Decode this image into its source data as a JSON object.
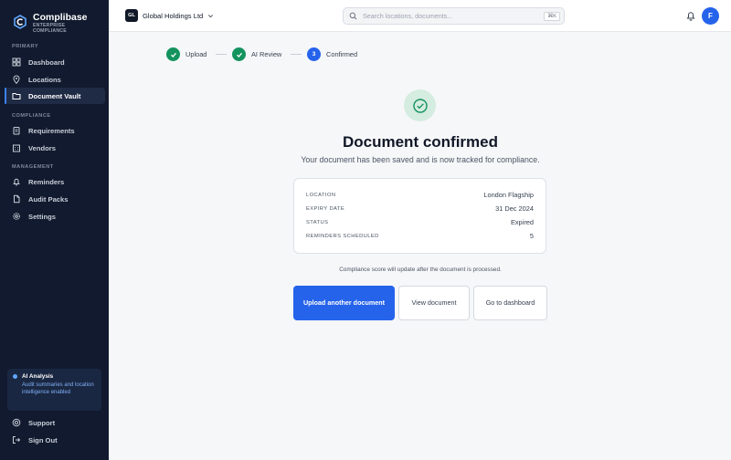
{
  "brand": {
    "name": "Complibase",
    "tagline_line1": "ENTERPRISE",
    "tagline_line2": "COMPLIANCE"
  },
  "sidebar": {
    "sections": {
      "primary": "PRIMARY",
      "compliance": "COMPLIANCE",
      "management": "MANAGEMENT"
    },
    "items": [
      {
        "label": "Dashboard",
        "icon": "grid-icon"
      },
      {
        "label": "Locations",
        "icon": "map-pin-icon"
      },
      {
        "label": "Document Vault",
        "icon": "folder-icon",
        "active": true
      },
      {
        "label": "Requirements",
        "icon": "clipboard-icon"
      },
      {
        "label": "Vendors",
        "icon": "building-icon"
      },
      {
        "label": "Reminders",
        "icon": "bell-icon"
      },
      {
        "label": "Audit Packs",
        "icon": "file-icon"
      },
      {
        "label": "Settings",
        "icon": "gear-icon"
      }
    ],
    "ai_card": {
      "title": "AI Analysis",
      "text": "Audit summaries and location intelligence enabled"
    },
    "footer": [
      {
        "label": "Support",
        "icon": "help-icon"
      },
      {
        "label": "Sign Out",
        "icon": "sign-out-icon"
      }
    ]
  },
  "topbar": {
    "org_badge": "GL",
    "org_name": "Global Holdings Ltd",
    "search_placeholder": "Search locations, documents...",
    "search_shortcut": "⌘K",
    "avatar_initial": "F"
  },
  "stepper": {
    "steps": [
      {
        "label": "Upload",
        "state": "done"
      },
      {
        "label": "AI Review",
        "state": "done"
      },
      {
        "label": "Confirmed",
        "state": "current",
        "number": "3"
      }
    ]
  },
  "confirmation": {
    "headline": "Document confirmed",
    "subline": "Your document has been saved and is now tracked for compliance.",
    "details": [
      {
        "key": "LOCATION",
        "value": "London Flagship"
      },
      {
        "key": "EXPIRY DATE",
        "value": "31 Dec 2024"
      },
      {
        "key": "STATUS",
        "value": "Expired"
      },
      {
        "key": "REMINDERS SCHEDULED",
        "value": "5"
      }
    ],
    "note": "Compliance score will update after the document is processed.",
    "buttons": {
      "upload_another": "Upload another document",
      "view_document": "View document",
      "go_dashboard": "Go to dashboard"
    }
  },
  "colors": {
    "sidebar_bg": "#111a2e",
    "accent_blue": "#2563eb",
    "success_green": "#14935e"
  }
}
